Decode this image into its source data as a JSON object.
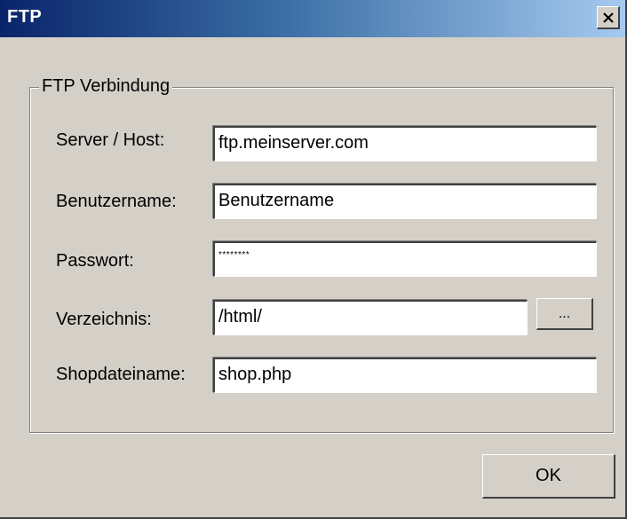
{
  "window": {
    "title": "FTP",
    "close_icon": "close-icon"
  },
  "group": {
    "legend": "FTP Verbindung"
  },
  "fields": {
    "server": {
      "label": "Server / Host:",
      "value": "ftp.meinserver.com"
    },
    "user": {
      "label": "Benutzername:",
      "value": "Benutzername"
    },
    "password": {
      "label": "Passwort:",
      "value": "********"
    },
    "directory": {
      "label": "Verzeichnis:",
      "value": "/html/"
    },
    "shopfile": {
      "label": "Shopdateiname:",
      "value": "shop.php"
    }
  },
  "buttons": {
    "browse_label": "...",
    "ok_label": "OK"
  }
}
